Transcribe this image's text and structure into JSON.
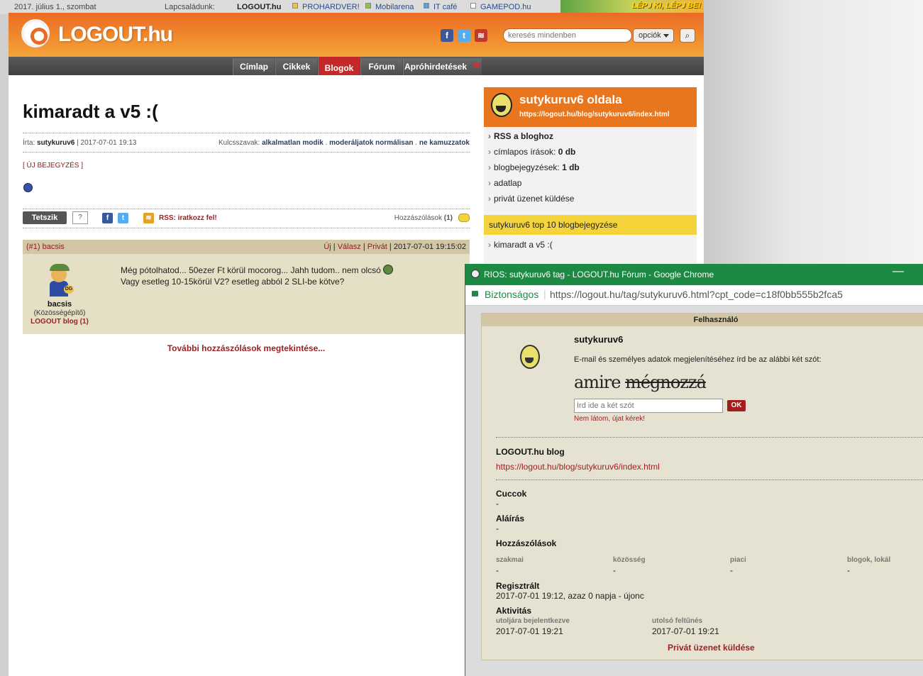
{
  "netbar": {
    "date": "2017. július 1., szombat",
    "family_label": "Lapcsaládunk:",
    "sites": [
      "LOGOUT.hu",
      "PROHARDVER!",
      "Mobilarena",
      "IT café",
      "GAMEPOD.hu"
    ],
    "banner": "LÉPJ KI, LÉPJ BE!"
  },
  "header": {
    "logo": "LOGOUT.hu",
    "search_placeholder": "keresés mindenben",
    "options_label": "opciók",
    "social_icons": [
      "facebook-icon",
      "twitter-icon",
      "rss-icon"
    ]
  },
  "nav": {
    "tabs": [
      "Címlap",
      "Cikkek",
      "Blogok",
      "Fórum",
      "Apróhirdetések"
    ],
    "active": "Blogok"
  },
  "post": {
    "title": "kimaradt a v5 :(",
    "author_label": "Írta:",
    "author": "sutykuruv6",
    "date": "2017-07-01 19:13",
    "keywords_label": "Kulcsszavak:",
    "keywords": [
      "alkalmatlan modik",
      "moderáljatok normálisan",
      "ne kamuzzatok"
    ],
    "new_entry": "[ ÚJ BEJEGYZÉS ]",
    "like_label": "Tetszik",
    "like_help": "?",
    "rss_label": "RSS: iratkozz fel!",
    "comments_label": "Hozzászólások",
    "comments_count": "(1)"
  },
  "comment": {
    "number": "(#1)",
    "user": "bacsis",
    "links": [
      "Új",
      "Válasz",
      "Privát"
    ],
    "datetime": "2017-07-01 19:15:02",
    "role": "(Közösségépítő)",
    "blog": "LOGOUT blog (1)",
    "line1": "Még pótolhatod... 50ezer Ft körül mocorog... Jahh tudom.. nem olcsó",
    "line2": "Vagy esetleg 10-15körül V2? esetleg abból 2 SLI-be kötve?",
    "more": "További hozzászólások megtekintése..."
  },
  "sidebar": {
    "title": "sutykuruv6 oldala",
    "url": "https://logout.hu/blog/sutykuruv6/index.html",
    "rss": "RSS a bloghoz",
    "items": [
      {
        "label": "címlapos írások:",
        "value": "0 db"
      },
      {
        "label": "blogbejegyzések:",
        "value": "1 db"
      },
      {
        "label": "adatlap",
        "value": ""
      },
      {
        "label": "privát üzenet küldése",
        "value": ""
      }
    ],
    "top_label": "sutykuruv6 top 10 blogbejegyzése",
    "top_items": [
      "kimaradt a v5 :("
    ]
  },
  "popup": {
    "window_title": "RIOS: sutykuruv6 tag - LOGOUT.hu Fórum - Google Chrome",
    "minimize": "—",
    "secure_label": "Biztonságos",
    "url": "https://logout.hu/tag/sutykuruv6.html?cpt_code=c18f0bb555b2fca5",
    "panel_header": "Felhasználó",
    "username": "sutykuruv6",
    "info": "E-mail és személyes adatok megjelenítéséhez írd be az alábbi két szót:",
    "captcha_a": "amire",
    "captcha_b": "mégnozzá",
    "input_placeholder": "Írd ide a két szót",
    "ok": "OK",
    "cant_see": "Nem látom, újat kérek!",
    "blog_label": "LOGOUT.hu blog",
    "blog_url": "https://logout.hu/blog/sutykuruv6/index.html",
    "cuccok_label": "Cuccok",
    "cuccok": "-",
    "alairas_label": "Aláírás",
    "alairas": "-",
    "hozz_label": "Hozzászólások",
    "hozz_cols": [
      {
        "label": "szakmai",
        "value": "-"
      },
      {
        "label": "közösség",
        "value": "-"
      },
      {
        "label": "piaci",
        "value": "-"
      },
      {
        "label": "blogok, lokál",
        "value": "-"
      }
    ],
    "reg_label": "Regisztrált",
    "reg": "2017-07-01 19:12, azaz 0 napja - újonc",
    "akt_label": "Aktivitás",
    "akt_cols": [
      {
        "label": "utoljára bejelentkezve",
        "value": "2017-07-01 19:21"
      },
      {
        "label": "utolsó feltűnés",
        "value": "2017-07-01 19:21"
      }
    ],
    "private_msg": "Privát üzenet küldése"
  }
}
